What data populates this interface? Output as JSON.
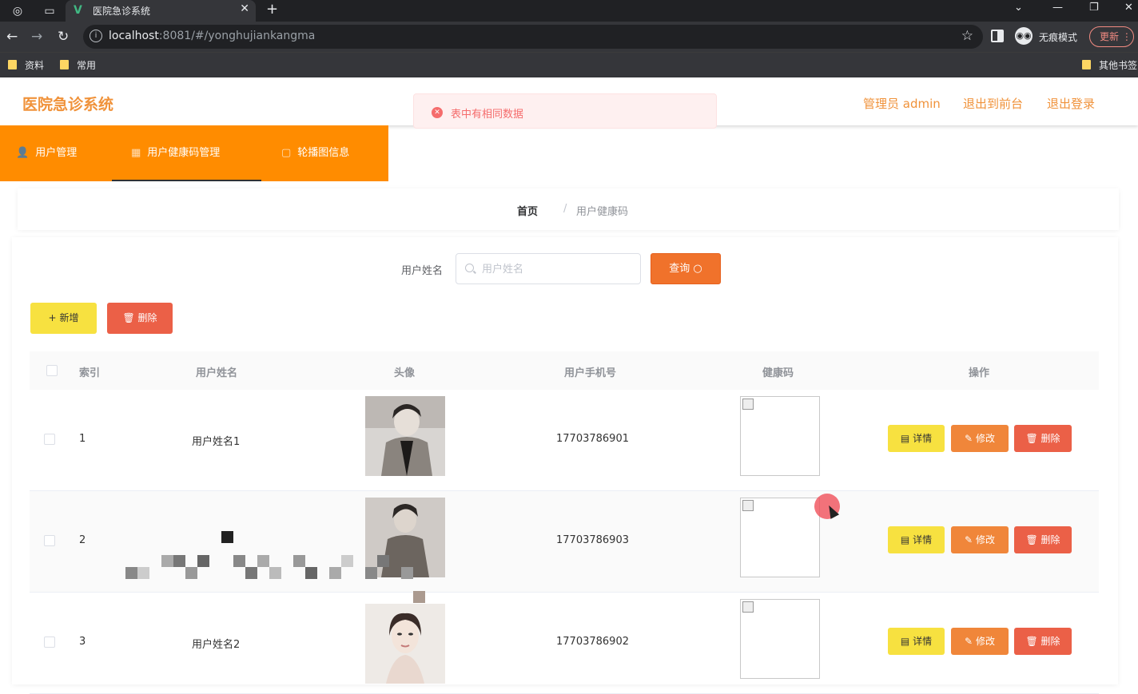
{
  "browser": {
    "tab_title": "医院急诊系统",
    "tab_logo": "V",
    "url_host": "localhost",
    "url_rest": ":8081/#/yonghujiankangma",
    "incognito_label": "无痕模式",
    "update_label": "更新",
    "bookmarks": [
      "资料",
      "常用"
    ],
    "other_bookmarks": "其他书签"
  },
  "header": {
    "brand": "医院急诊系统",
    "admin_label": "管理员 admin",
    "to_front_label": "退出到前台",
    "logout_label": "退出登录"
  },
  "toast": {
    "message": "表中有相同数据"
  },
  "menu": {
    "items": [
      {
        "label": "用户管理",
        "icon": "user-icon",
        "active": false
      },
      {
        "label": "用户健康码管理",
        "icon": "grid-icon",
        "active": true
      },
      {
        "label": "轮播图信息",
        "icon": "image-icon",
        "active": false
      }
    ]
  },
  "breadcrumb": {
    "home": "首页",
    "separator": "/",
    "current": "用户健康码"
  },
  "search": {
    "label": "用户姓名",
    "placeholder": "用户姓名",
    "value": "",
    "button_label": "查询"
  },
  "actions": {
    "add_label": "新增",
    "delete_label": "删除"
  },
  "table": {
    "headers": [
      "索引",
      "用户姓名",
      "头像",
      "用户手机号",
      "健康码",
      "操作"
    ],
    "rows": [
      {
        "index": "1",
        "name": "用户姓名1",
        "phone": "17703786901"
      },
      {
        "index": "2",
        "name": "",
        "phone": "17703786903"
      },
      {
        "index": "3",
        "name": "用户姓名2",
        "phone": "17703786902"
      }
    ],
    "row_buttons": {
      "detail": "详情",
      "edit": "修改",
      "delete": "删除"
    }
  },
  "colors": {
    "brand": "#f0923a",
    "menu_bg": "#ff8c00",
    "danger": "#eb6047",
    "warning": "#f7e140",
    "primary": "#f0722b"
  }
}
